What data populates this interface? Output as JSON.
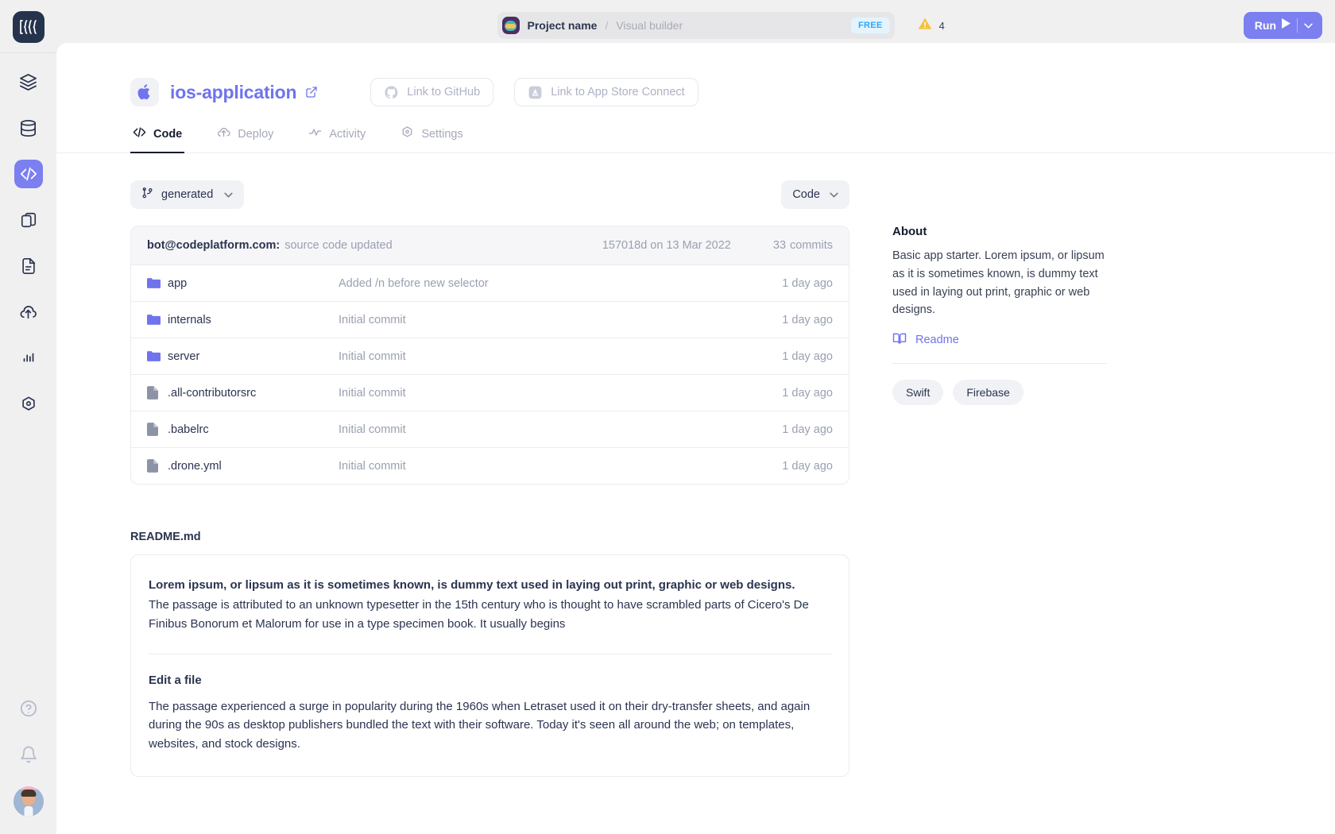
{
  "rail": {
    "logo_icon": "codeplatform-logo-icon",
    "items": [
      {
        "icon": "layers-icon",
        "name": "sidebar-item-layers",
        "active": false
      },
      {
        "icon": "database-icon",
        "name": "sidebar-item-database",
        "active": false
      },
      {
        "icon": "code-icon",
        "name": "sidebar-item-code",
        "active": true
      },
      {
        "icon": "copy-icon",
        "name": "sidebar-item-pages",
        "active": false
      },
      {
        "icon": "document-icon",
        "name": "sidebar-item-documents",
        "active": false
      },
      {
        "icon": "cloud-upload-icon",
        "name": "sidebar-item-deploy",
        "active": false
      },
      {
        "icon": "bar-chart-icon",
        "name": "sidebar-item-analytics",
        "active": false
      },
      {
        "icon": "hexagon-settings-icon",
        "name": "sidebar-item-settings",
        "active": false
      }
    ],
    "bottom": [
      {
        "icon": "help-circle-icon",
        "name": "help-button"
      },
      {
        "icon": "bell-icon",
        "name": "notifications-button"
      }
    ]
  },
  "topbar": {
    "project_icon": "project-avatar-icon",
    "project_name": "Project name",
    "separator": "/",
    "project_section": "Visual builder",
    "plan_badge": "FREE",
    "warning_icon": "warning-triangle-icon",
    "warning_count": "4",
    "run_label": "Run",
    "run_play_icon": "play-icon",
    "run_caret_icon": "chevron-down-icon"
  },
  "repo": {
    "platform_icon": "apple-icon",
    "name": "ios-application",
    "external_link_icon": "external-link-icon",
    "link_github": "Link to GitHub",
    "link_github_icon": "github-icon",
    "link_appstore": "Link to App Store Connect",
    "link_appstore_icon": "app-store-icon"
  },
  "tabs": [
    {
      "label": "Code",
      "icon": "code-icon",
      "active": true
    },
    {
      "label": "Deploy",
      "icon": "cloud-upload-icon",
      "active": false
    },
    {
      "label": "Activity",
      "icon": "activity-pulse-icon",
      "active": false
    },
    {
      "label": "Settings",
      "icon": "hexagon-settings-icon",
      "active": false
    }
  ],
  "toolbar": {
    "branch_icon": "git-branch-icon",
    "branch_label": "generated",
    "branch_caret_icon": "chevron-down-icon",
    "code_label": "Code",
    "code_caret_icon": "chevron-down-icon"
  },
  "commit_bar": {
    "author": "bot@codeplatform.com:",
    "message": "source code updated",
    "hash_date": "157018d on 13 Mar 2022",
    "commit_count": "33",
    "commit_word": "commits"
  },
  "files": [
    {
      "type": "folder",
      "icon": "folder-icon",
      "name": "app",
      "message": "Added /n before new selector",
      "age": "1 day ago"
    },
    {
      "type": "folder",
      "icon": "folder-icon",
      "name": "internals",
      "message": "Initial commit",
      "age": "1 day ago"
    },
    {
      "type": "folder",
      "icon": "folder-icon",
      "name": "server",
      "message": "Initial commit",
      "age": "1 day ago"
    },
    {
      "type": "file",
      "icon": "file-icon",
      "name": ".all-contributorsrc",
      "message": "Initial commit",
      "age": "1 day ago"
    },
    {
      "type": "file",
      "icon": "file-icon",
      "name": ".babelrc",
      "message": "Initial commit",
      "age": "1 day ago"
    },
    {
      "type": "file",
      "icon": "file-icon",
      "name": ".drone.yml",
      "message": "Initial commit",
      "age": "1 day ago"
    }
  ],
  "readme": {
    "label": "README.md",
    "lead": "Lorem ipsum, or lipsum as it is sometimes known, is dummy text used in laying out print, graphic or web designs.",
    "paragraph": "The passage is attributed to an unknown typesetter in the 15th century who is thought to have scrambled parts of Cicero's De Finibus Bonorum et Malorum for use in a type specimen book. It usually begins",
    "section_title": "Edit a file",
    "section_body": "The passage experienced a surge in popularity during the 1960s when Letraset used it on their dry-transfer sheets, and again during the 90s as desktop publishers bundled the text with their software. Today it's seen all around the web; on templates, websites, and stock designs."
  },
  "about": {
    "title": "About",
    "description": "Basic app starter. Lorem ipsum, or lipsum as it is sometimes known, is dummy text used in laying out print, graphic or web designs.",
    "readme_link": "Readme",
    "readme_link_icon": "book-icon",
    "tags": [
      "Swift",
      "Firebase"
    ]
  },
  "colors": {
    "accent": "#6f74ee",
    "accent_button": "#7b7ff0",
    "badge_free_bg": "#e3f4fd",
    "badge_free_text": "#2fa8f5",
    "warning": "#f5c33b",
    "text_dark": "#2b3450",
    "text_muted": "#9aa0b2",
    "panel_bg": "#ffffff",
    "shell_bg": "#f0f0f1"
  }
}
